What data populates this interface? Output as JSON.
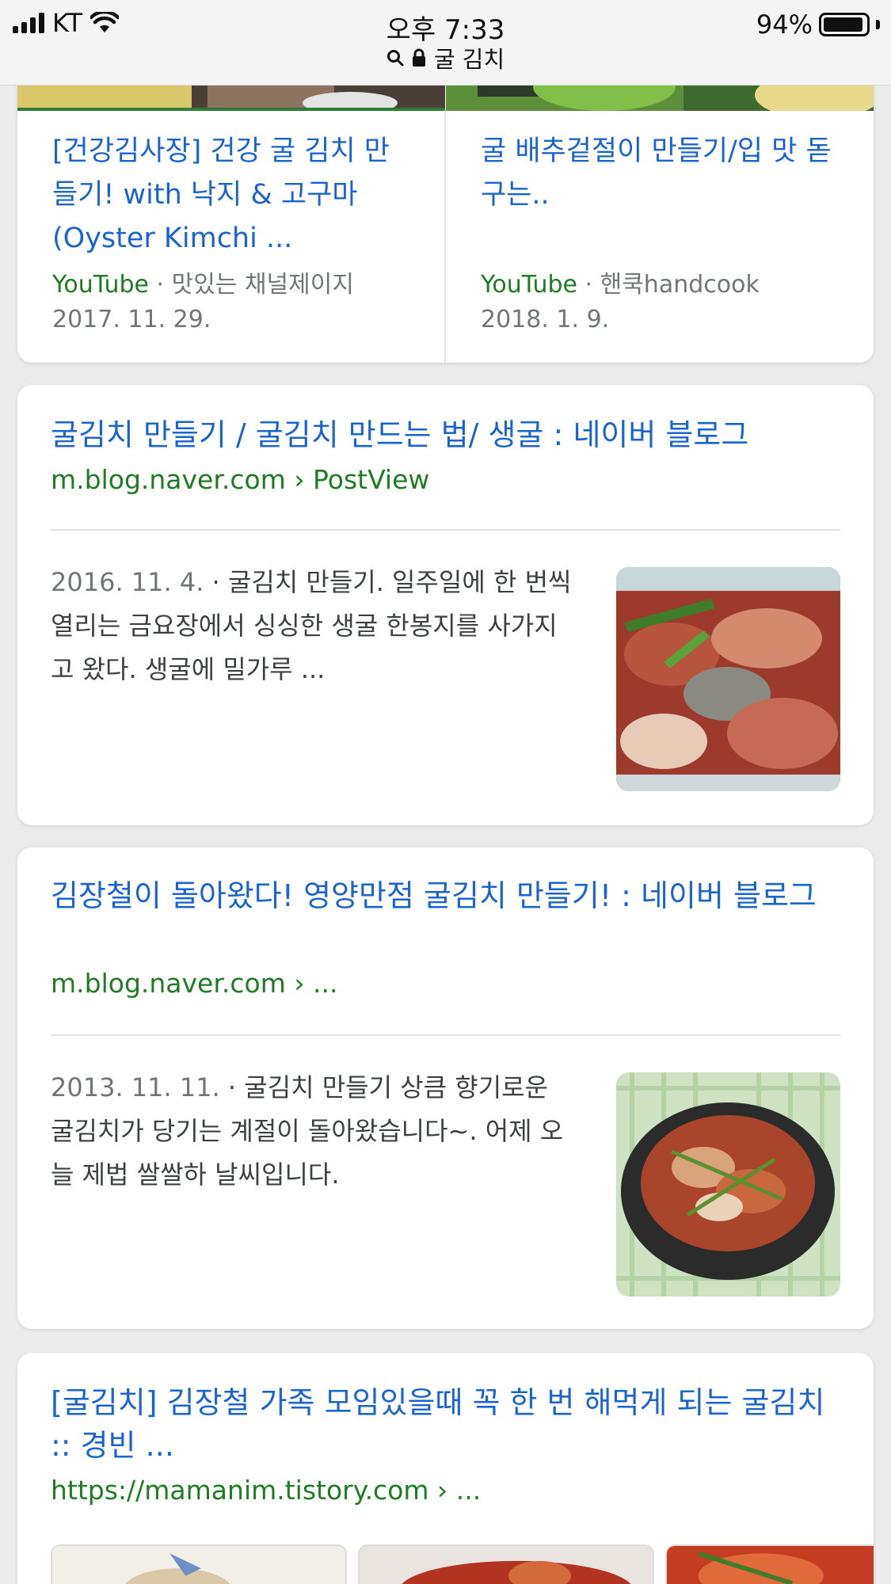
{
  "status_bar": {
    "carrier": "KT",
    "time": "오후 7:33",
    "battery": "94%",
    "battery_level": 0.94,
    "url_text": "굴 김치"
  },
  "video_results": [
    {
      "title": "[건강김사장] 건강 굴 김치 만들기! with 낙지 & 고구마 (Oyster Kimchi ...",
      "source": "YouTube",
      "channel": " · 맛있는 채널제이지",
      "date": "2017. 11. 29."
    },
    {
      "title": "굴 배추겉절이 만들기/입 맛 돋구는..",
      "source": "YouTube",
      "channel": " · 핸쿡handcook",
      "date": "2018. 1. 9."
    }
  ],
  "results": [
    {
      "title": "굴김치 만들기 / 굴김치 만드는 법/ 생굴 : 네이버 블로그",
      "url": "m.blog.naver.com › PostView",
      "date": "2016. 11. 4.",
      "snippet": " · 굴김치 만들기. 일주일에 한 번씩 열리는 금요장에서 싱싱한 생굴 한봉지를 사가지고 왔다. 생굴에 밀가루 ..."
    },
    {
      "title": "김장철이 돌아왔다! 영양만점 굴김치 만들기! : 네이버 블로그",
      "url": "m.blog.naver.com › ...",
      "date": "2013. 11. 11.",
      "snippet": " · 굴김치 만들기 상큼 향기로운 굴김치가 당기는 계절이 돌아왔습니다~. 어제 오늘 제법 쌀쌀하 날씨입니다."
    },
    {
      "title": "[굴김치] 김장철 가족 모임있을때 꼭 한 번 해먹게 되는 굴김치 :: 경빈 ...",
      "url": "https://mamanim.tistory.com › ..."
    }
  ],
  "icons": {
    "signal": "signal-bars-icon",
    "wifi": "wifi-icon",
    "battery": "battery-icon",
    "search": "search-icon",
    "lock": "lock-icon"
  }
}
